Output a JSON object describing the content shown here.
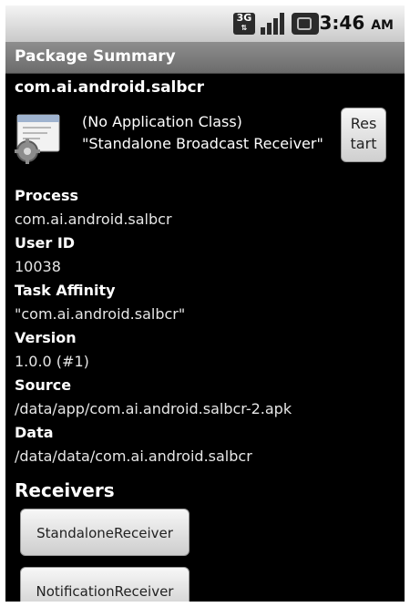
{
  "status_bar": {
    "network_label": "3G",
    "network_arrows": "⇅",
    "time": "3:46",
    "ampm": "AM"
  },
  "title_bar": {
    "title": "Package Summary"
  },
  "package": {
    "name": "com.ai.android.salbcr",
    "app_class": "(No Application Class)",
    "app_label": "\"Standalone Broadcast Receiver\"",
    "restart_line1": "Res",
    "restart_line2": "tart"
  },
  "details": [
    {
      "label": "Process",
      "value": "com.ai.android.salbcr"
    },
    {
      "label": "User ID",
      "value": "10038"
    },
    {
      "label": "Task Affinity",
      "value": "\"com.ai.android.salbcr\""
    },
    {
      "label": "Version",
      "value": "1.0.0 (#1)"
    },
    {
      "label": "Source",
      "value": "/data/app/com.ai.android.salbcr-2.apk"
    },
    {
      "label": "Data",
      "value": "/data/data/com.ai.android.salbcr"
    }
  ],
  "receivers": {
    "title": "Receivers",
    "items": [
      "StandaloneReceiver",
      "NotificationReceiver"
    ]
  },
  "colors": {
    "background": "#000000",
    "title_bar": "#7a7a7a",
    "status_bar": "#dcdcdc"
  }
}
